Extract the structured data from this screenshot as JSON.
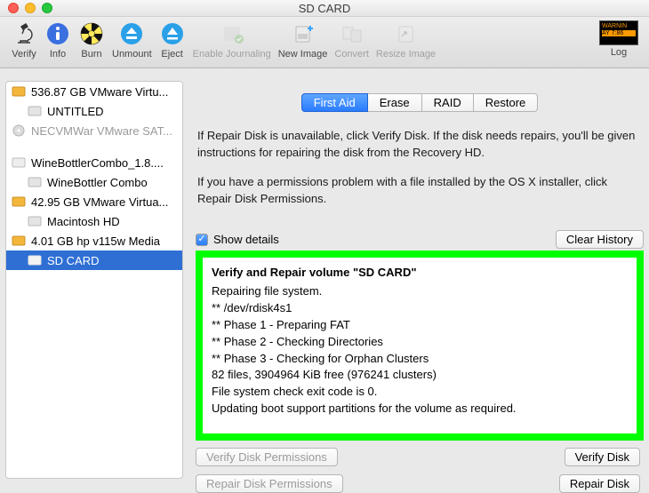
{
  "window": {
    "title": "SD CARD"
  },
  "toolbar": {
    "items": [
      {
        "id": "verify",
        "label": "Verify",
        "enabled": true
      },
      {
        "id": "info",
        "label": "Info",
        "enabled": true
      },
      {
        "id": "burn",
        "label": "Burn",
        "enabled": true
      },
      {
        "id": "unmount",
        "label": "Unmount",
        "enabled": true
      },
      {
        "id": "eject",
        "label": "Eject",
        "enabled": true
      },
      {
        "id": "enable_journaling",
        "label": "Enable Journaling",
        "enabled": false
      },
      {
        "id": "new_image",
        "label": "New Image",
        "enabled": true
      },
      {
        "id": "convert",
        "label": "Convert",
        "enabled": false
      },
      {
        "id": "resize_image",
        "label": "Resize Image",
        "enabled": false
      }
    ],
    "log_label": "Log",
    "warnin_badge_line1": "WARNIN",
    "warnin_badge_line2": "AY 7:86"
  },
  "sidebar": {
    "groups": [
      {
        "disk": "536.87 GB VMware Virtu...",
        "disk_icon": "hdd-yellow",
        "children": [
          {
            "label": "UNTITLED",
            "icon": "vol-gray"
          }
        ],
        "extra": [
          {
            "label": "NECVMWar VMware SAT...",
            "icon": "optical-gray"
          }
        ]
      },
      {
        "disk": "WineBottlerCombo_1.8....",
        "disk_icon": "dmg-gray",
        "children": [
          {
            "label": "WineBottler Combo",
            "icon": "vol-gray"
          }
        ]
      },
      {
        "disk": "42.95 GB VMware Virtua...",
        "disk_icon": "hdd-yellow",
        "children": [
          {
            "label": "Macintosh HD",
            "icon": "vol-gray"
          }
        ]
      },
      {
        "disk": "4.01 GB hp v115w Media",
        "disk_icon": "hdd-yellow",
        "children": [
          {
            "label": "SD CARD",
            "icon": "vol-gray",
            "selected": true
          }
        ]
      }
    ]
  },
  "tabs": [
    "First Aid",
    "Erase",
    "RAID",
    "Restore"
  ],
  "tabs_active": 0,
  "info_p1": "If Repair Disk is unavailable, click Verify Disk. If the disk needs repairs, you'll be given instructions for repairing the disk from the Recovery HD.",
  "info_p2": "If you have a permissions problem with a file installed by the OS X installer, click Repair Disk Permissions.",
  "show_details_label": "Show details",
  "clear_history_label": "Clear History",
  "console": {
    "heading": "Verify and Repair volume \"SD CARD\"",
    "lines": [
      "Repairing file system.",
      "** /dev/rdisk4s1",
      "** Phase 1 - Preparing FAT",
      "** Phase 2 - Checking Directories",
      "** Phase 3 - Checking for Orphan Clusters",
      "82 files, 3904964 KiB free (976241 clusters)",
      "File system check exit code is 0.",
      "Updating boot support partitions for the volume as required."
    ]
  },
  "buttons": {
    "verify_perm": "Verify Disk Permissions",
    "verify_disk": "Verify Disk",
    "repair_perm": "Repair Disk Permissions",
    "repair_disk": "Repair Disk"
  }
}
